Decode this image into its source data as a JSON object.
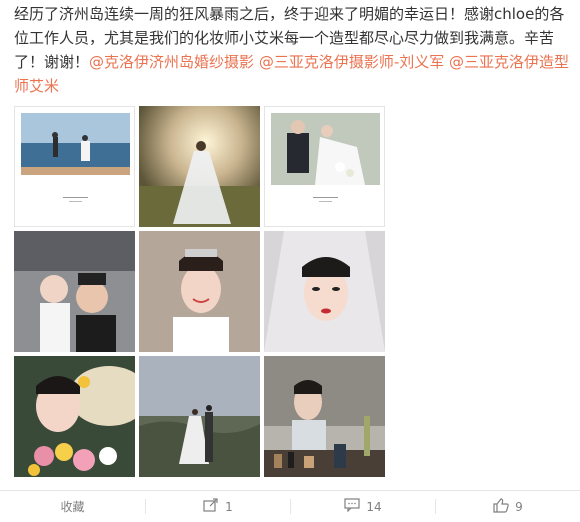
{
  "post": {
    "text_part1": "经历了济州岛连续一周的狂风暴雨之后，终于迎来了明媚的幸运日！感谢chloe的各位工作人员，尤其是我们的化妆师小艾米每一个造型都尽心尽力做到我满意。辛苦了！谢谢！",
    "mention1": "@克洛伊济州岛婚纱摄影",
    "mention2": "@三亚克洛伊摄影师-刘义军",
    "mention3": "@三亚克洛伊造型师艾米"
  },
  "photos": [
    {
      "label": "photo-seaside-couple"
    },
    {
      "label": "photo-bride-sunset-field"
    },
    {
      "label": "photo-couple-flowers"
    },
    {
      "label": "photo-selfie-couple"
    },
    {
      "label": "photo-bride-smile-veil"
    },
    {
      "label": "photo-bride-closeup"
    },
    {
      "label": "photo-bride-flowers-selfie"
    },
    {
      "label": "photo-couple-landscape"
    },
    {
      "label": "photo-makeup-mirror"
    }
  ],
  "actions": {
    "favorite_label": "收藏",
    "repost_count": "1",
    "comment_count": "14",
    "like_count": "9"
  },
  "colors": {
    "mention": "#eb7350",
    "text": "#333333",
    "action": "#808080"
  }
}
